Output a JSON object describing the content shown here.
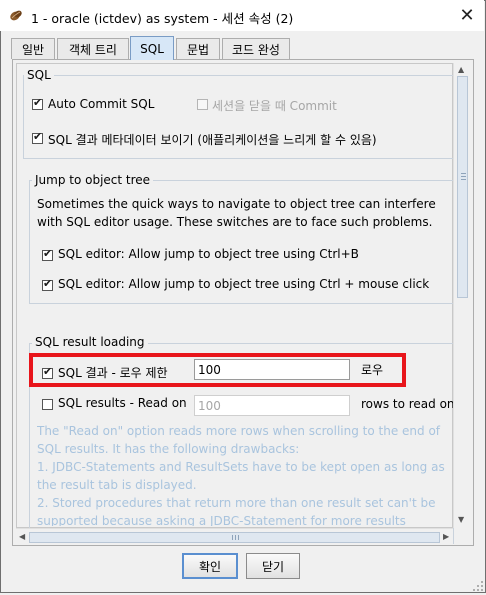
{
  "window": {
    "title": "1 - oracle (ictdev)  as system - 세션 속성 (2)",
    "close_glyph": "✕"
  },
  "tabs": [
    {
      "label": "일반",
      "active": false
    },
    {
      "label": "객체 트리",
      "active": false
    },
    {
      "label": "SQL",
      "active": true
    },
    {
      "label": "문법",
      "active": false
    },
    {
      "label": "코드 완성",
      "active": false
    }
  ],
  "sql_section": {
    "title": "SQL",
    "auto_commit": {
      "label": "Auto Commit SQL",
      "checked": true
    },
    "commit_on_close": {
      "label": "세션을 닫을 때 Commit",
      "checked": false,
      "enabled": false
    },
    "show_metadata": {
      "label": "SQL 결과 메타데이터 보이기 (애플리케이션을 느리게 할 수 있음)",
      "checked": true
    }
  },
  "jump_section": {
    "title": "Jump to object tree",
    "description": "Sometimes the quick ways to navigate to object tree can interfere with SQL editor usage. These switches are to face such problems.",
    "ctrl_b": {
      "label": "SQL editor: Allow jump to object tree using Ctrl+B",
      "checked": true
    },
    "ctrl_click": {
      "label": "SQL editor: Allow jump to object tree using Ctrl + mouse click",
      "checked": true
    }
  },
  "loading_section": {
    "title": "SQL result loading",
    "row_limit": {
      "label": "SQL 결과 - 로우 제한",
      "checked": true,
      "value": "100",
      "unit": "로우"
    },
    "read_on": {
      "label": "SQL results - Read on",
      "checked": false,
      "value": "100",
      "unit": "rows to read on"
    },
    "description": "The \"Read on\" option reads more rows when scrolling to the end of SQL results. It has the following drawbacks:\n1. JDBC-Statements and ResultSets have to be kept open as long as the result tab is displayed.\n2. Stored procedures that return more than one result set can't be supported because asking a JDBC-Statement for more results intrinsically"
  },
  "buttons": {
    "ok": "확인",
    "close": "닫기"
  },
  "colors": {
    "highlight": "#e8151b",
    "active_tab": "#d7e7f7",
    "group_border": "#c9d2dc"
  },
  "icons": {
    "app": "coffee-bean-icon",
    "close": "close-icon",
    "scroll_up": "scroll-up-icon",
    "scroll_down": "scroll-down-icon",
    "scroll_left": "scroll-left-icon",
    "scroll_right": "scroll-right-icon"
  }
}
